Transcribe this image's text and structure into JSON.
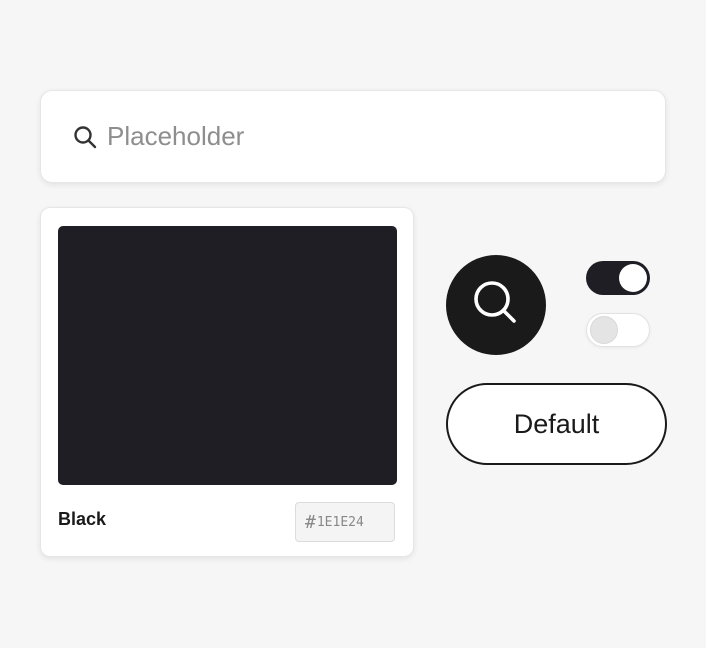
{
  "search": {
    "placeholder": "Placeholder",
    "value": "",
    "icon": "search-icon"
  },
  "swatch": {
    "name": "Black",
    "hash": "#",
    "hex": "1E1E24",
    "color": "#1E1E24"
  },
  "icon_button": {
    "icon": "search-icon",
    "background": "#1a1a1a"
  },
  "toggles": [
    {
      "state": "on"
    },
    {
      "state": "off"
    }
  ],
  "default_button": {
    "label": "Default"
  }
}
